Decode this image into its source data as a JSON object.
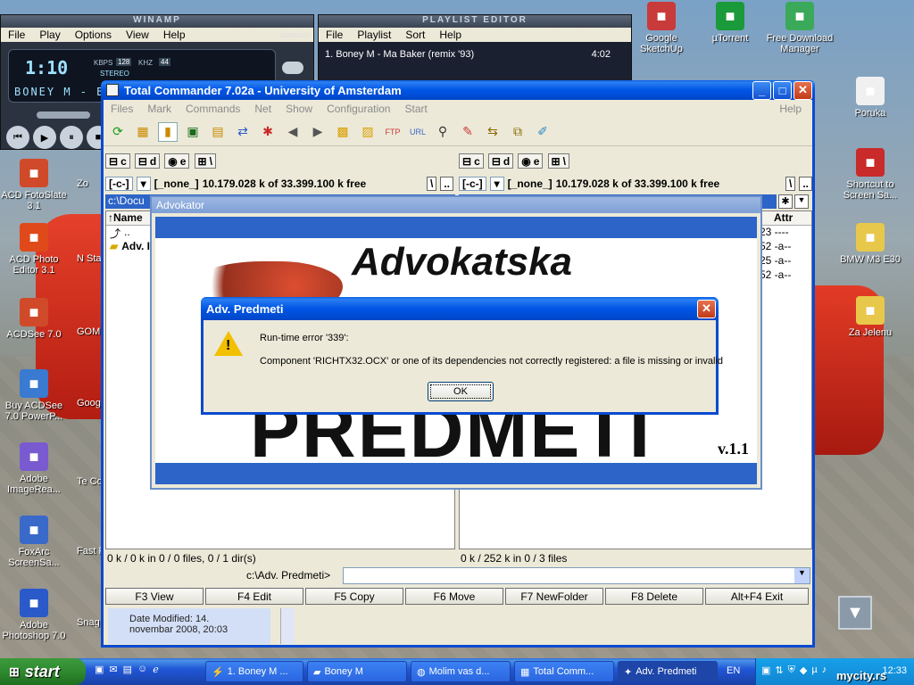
{
  "desktop": {
    "left_icons": [
      {
        "label": "ACD FotoSlate 3.1",
        "icon": "acd-fotoslate-icon"
      },
      {
        "label": "ACD Photo Editor 3.1",
        "icon": "acd-photo-editor-icon"
      },
      {
        "label": "ACDSee 7.0",
        "icon": "acdsee-icon"
      },
      {
        "label": "Buy ACDSee 7.0 PowerP...",
        "icon": "acdsee-powerpack-icon"
      },
      {
        "label": "Adobe ImageRea...",
        "icon": "adobe-imageready-icon"
      },
      {
        "label": "FoxArc ScreenSa...",
        "icon": "foxarc-icon"
      },
      {
        "label": "Adobe Photoshop 7.0",
        "icon": "photoshop-icon"
      }
    ],
    "left_partial": [
      "Zo",
      "N Start",
      "GOM",
      "Googl",
      "Te Comm",
      "Fast Photo",
      "Snag"
    ],
    "top_icons": [
      {
        "label": "Google SketchUp",
        "icon": "sketchup-icon"
      },
      {
        "label": "µTorrent",
        "icon": "utorrent-icon"
      },
      {
        "label": "Free Download Manager",
        "icon": "fdm-icon"
      }
    ],
    "right_icons": [
      {
        "label": "Poruka",
        "icon": "shortcut-icon"
      },
      {
        "label": "Shortcut to Screen Sa...",
        "icon": "screen-saver-icon"
      },
      {
        "label": "BMW M3 E30",
        "icon": "folder-icon"
      },
      {
        "label": "Za Jelenu",
        "icon": "folder-icon"
      }
    ],
    "watermark": "mycity.rs"
  },
  "winamp": {
    "title": "WINAMP",
    "menu": [
      "File",
      "Play",
      "Options",
      "View",
      "Help"
    ],
    "time": "1:10",
    "kbps_label": "KBPS",
    "kbps": "128",
    "khz_label": "KHZ",
    "khz": "44",
    "stereo": "STEREO",
    "marquee": "BONEY M - B",
    "video_vis": "VIDEO/VIS"
  },
  "playlist": {
    "title": "PLAYLIST EDITOR",
    "menu": [
      "File",
      "Playlist",
      "Sort",
      "Help"
    ],
    "track": "1. Boney M - Ma Baker (remix '93)",
    "duration": "4:02"
  },
  "tc": {
    "title": "Total Commander 7.02a - University of Amsterdam",
    "menu": [
      "Files",
      "Mark",
      "Commands",
      "Net",
      "Show",
      "Configuration",
      "Start"
    ],
    "help": "Help",
    "drives": [
      "c",
      "d",
      "e",
      "\\"
    ],
    "left": {
      "drive": "[-c-]",
      "label": "[_none_]",
      "free": "10.179.028 k of 33.399.100 k free",
      "path": "c:\\Docu",
      "col": "↑Name",
      "rows": [
        "..",
        "Adv. I"
      ],
      "status": "0 k / 0 k in 0 / 0 files, 0 / 1 dir(s)"
    },
    "right": {
      "drive": "[-c-]",
      "label": "[_none_]",
      "free": "10.179.028 k of 33.399.100 k free",
      "col": "Attr",
      "rows": [
        "23 ----",
        "52 -a--",
        "25 -a--",
        "52 -a--"
      ],
      "status": "0 k / 252 k in 0 / 3 files"
    },
    "root_btn": "\\",
    "up_btn": "..",
    "cmd_path": "c:\\Adv. Predmeti>",
    "fkeys": [
      "F3 View",
      "F4 Edit",
      "F5 Copy",
      "F6 Move",
      "F7 NewFolder",
      "F8 Delete",
      "Alt+F4 Exit"
    ],
    "details": "Date Modified: 14. novembar 2008, 20:03"
  },
  "advokator": {
    "title": "Advokator",
    "heading": "Advokatska",
    "big": "PREDMETI",
    "version": "v.1.1"
  },
  "dialog": {
    "title": "Adv. Predmeti",
    "line1": "Run-time error '339':",
    "line2": "Component 'RICHTX32.OCX' or one of its dependencies not correctly registered: a file is missing or invalid",
    "ok": "OK"
  },
  "taskbar": {
    "start": "start",
    "tasks": [
      "1. Boney M ...",
      "Boney M",
      "Molim vas d...",
      "Total Comm...",
      "Adv. Predmeti"
    ],
    "lang": "EN",
    "clock": "12:33"
  },
  "colors": {
    "xp_blue": "#0055e5",
    "dialog_bg": "#ece9d8",
    "accent": "#2c64c8"
  }
}
